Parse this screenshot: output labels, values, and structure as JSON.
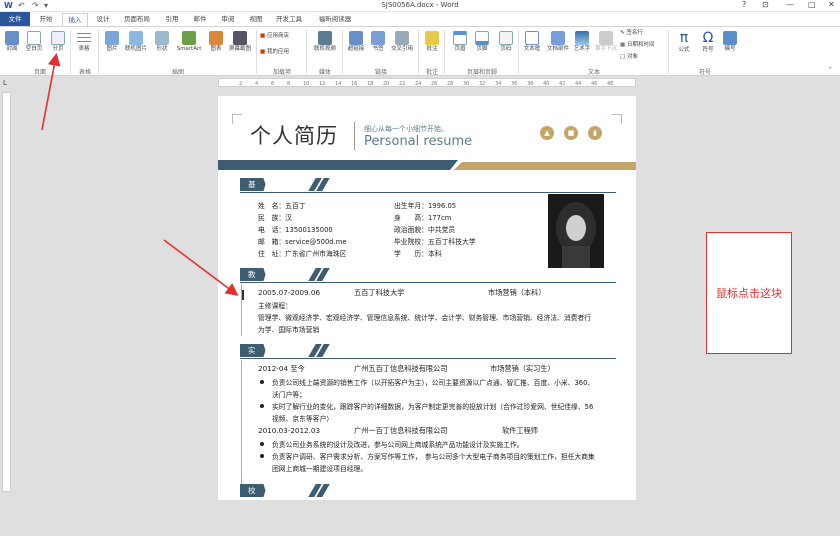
{
  "window": {
    "title": "SJS0056A.docx - Word",
    "controls": [
      "?",
      "⊡",
      "—",
      "□",
      "✕"
    ]
  },
  "quick_access": [
    "W",
    "↶",
    "↷",
    "▾"
  ],
  "tabs": [
    "文件",
    "开始",
    "插入",
    "设计",
    "页面布局",
    "引用",
    "邮件",
    "审阅",
    "视图",
    "开发工具",
    "福昕阅读器"
  ],
  "active_tab": "插入",
  "ribbon": {
    "buttons": [
      "封面",
      "空白页",
      "分页",
      "表格",
      "图片",
      "联机图片",
      "形状",
      "SmartArt",
      "图表",
      "屏幕截图",
      "联机视频",
      "超链接",
      "书签",
      "交叉引用",
      "批注",
      "页眉",
      "页脚",
      "页码",
      "文本框",
      "文档部件",
      "艺术字",
      "首字下沉",
      "公式",
      "符号",
      "编号"
    ],
    "small_buttons": [
      "应用商店",
      "我的应用",
      "签名行",
      "日期和时间",
      "对象"
    ],
    "groups": [
      "页面",
      "表格",
      "插图",
      "加载项",
      "媒体",
      "链接",
      "批注",
      "页眉和页脚",
      "文本",
      "符号"
    ]
  },
  "ruler_ticks": [
    "2",
    "4",
    "6",
    "8",
    "10",
    "12",
    "14",
    "16",
    "18",
    "20",
    "22",
    "24",
    "26",
    "28",
    "30",
    "32",
    "34",
    "36",
    "38",
    "40",
    "42",
    "44",
    "46",
    "48"
  ],
  "resume": {
    "title": "个人简历",
    "slogan": "细心从每一个小细节开始。",
    "english": "Personal resume",
    "header_icons": [
      "graduation-cap-icon",
      "briefcase-icon",
      "phone-icon"
    ],
    "sections": [
      "基本信息",
      "教育背景",
      "实习经历",
      "校园经历"
    ],
    "basic": {
      "left": [
        "姓　名：五百丁",
        "民　族：汉",
        "电　话：13500135000",
        "邮　箱：service@500d.me",
        "住　址：广东省广州市海珠区"
      ],
      "right": [
        "出生年月：1996.05",
        "身　　高：177cm",
        "政治面貌：中共党员",
        "毕业院校：五百丁科技大学",
        "学　　历：本科"
      ]
    },
    "education": {
      "period": "2005.07-2009.06",
      "school": "五百丁科技大学",
      "major": "市场营销（本科）",
      "courses_label": "主修课程：",
      "courses": [
        "管理学、微观经济学、宏观经济学、管理信息系统、统计学、会计学、财务管理、市场营销、经济法、消费者行",
        "为学、国际市场营销"
      ]
    },
    "internships": [
      {
        "period": "2012-04 至今",
        "company": "广州五百丁信息科技有限公司",
        "role": "市场营销（实习生）",
        "bullets": [
          [
            "负责公司线上端资源的销售工作（以开拓客户为主），公司主要资源以广点通、智汇推、百度、小米、360、",
            "沃门户等；"
          ],
          [
            "实时了解行业的变化，跟踪客户的详细数据，为客户制定更完善的投放计划（合作过珍爱网、世纪佳缘、56",
            "视频、京东等客户）"
          ]
        ]
      },
      {
        "period": "2010.03-2012.03",
        "company": "广州一百丁信息科技有限公司",
        "role": "软件工程师",
        "bullets": [
          [
            "负责公司业务系统的设计及改进，参与公司网上商城系统产品功能设计及实施工作。"
          ],
          [
            "负责客户调研、客户需求分析、方案写作等工作，　参与公司多个大型电子商务项目的策划工作，担任大商集",
            "团网上商城一期建设项目经理。"
          ]
        ]
      }
    ]
  },
  "annotation": {
    "label": "鼠标点击这块"
  },
  "colors": {
    "accent": "#3e5d70",
    "gold": "#c4a46b",
    "word_blue": "#2b579a",
    "annotation_red": "#e03030"
  }
}
